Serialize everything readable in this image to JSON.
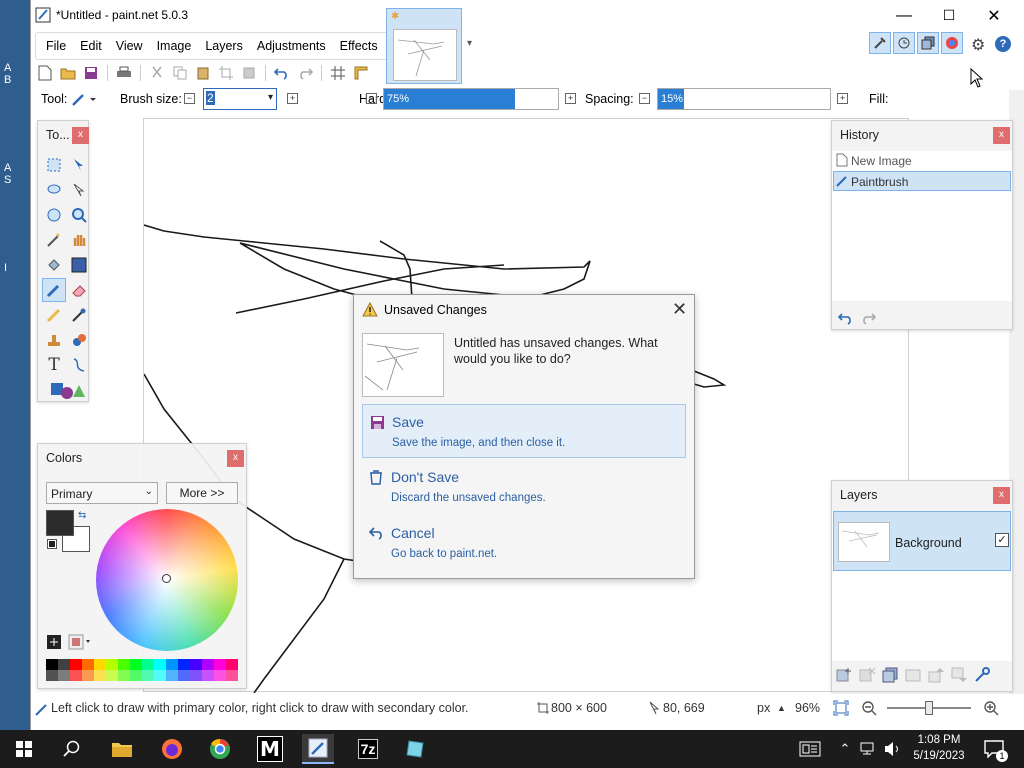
{
  "window": {
    "title": "*Untitled - paint.net 5.0.3",
    "minimize": "—",
    "maximize": "☐",
    "close": "✕"
  },
  "menu": [
    "File",
    "Edit",
    "View",
    "Image",
    "Layers",
    "Adjustments",
    "Effects"
  ],
  "options": {
    "tool_label": "Tool:",
    "brush_size_label": "Brush size:",
    "brush_size_value": "2",
    "hardness_label": "Hardness:",
    "hardness_value": "75%",
    "hardness_fraction": 0.75,
    "spacing_label": "Spacing:",
    "spacing_value": "15%",
    "spacing_fraction": 0.15,
    "fill_label": "Fill:"
  },
  "tools_panel": {
    "title": "To...",
    "close": "x"
  },
  "history_panel": {
    "title": "History",
    "close": "x",
    "items": [
      "New Image",
      "Paintbrush"
    ]
  },
  "layers_panel": {
    "title": "Layers",
    "close": "x",
    "layer_name": "Background"
  },
  "colors_panel": {
    "title": "Colors",
    "close": "x",
    "mode": "Primary",
    "more_button": "More >>",
    "primary_color": "#2b2b2b",
    "secondary_color": "#ffffff",
    "palette": [
      "#000000",
      "#404040",
      "#ff0000",
      "#ff6a00",
      "#ffd800",
      "#b6ff00",
      "#4cff00",
      "#00ff21",
      "#00ff90",
      "#00ffff",
      "#0094ff",
      "#0026ff",
      "#4800ff",
      "#b200ff",
      "#ff00dc",
      "#ff006e"
    ]
  },
  "dialog": {
    "title": "Unsaved Changes",
    "message": "Untitled has unsaved changes. What would you like to do?",
    "options": [
      {
        "title": "Save",
        "subtitle": "Save the image, and then close it."
      },
      {
        "title": "Don't Save",
        "subtitle": "Discard the unsaved changes."
      },
      {
        "title": "Cancel",
        "subtitle": "Go back to paint.net."
      }
    ]
  },
  "status": {
    "hint": "Left click to draw with primary color, right click to draw with secondary color.",
    "image_size": "800 × 600",
    "cursor_pos": "80, 669",
    "units": "px",
    "zoom": "96%"
  },
  "taskbar": {
    "time": "1:08 PM",
    "date": "5/19/2023",
    "notification_count": "1"
  },
  "accent": "#2d6ab8"
}
